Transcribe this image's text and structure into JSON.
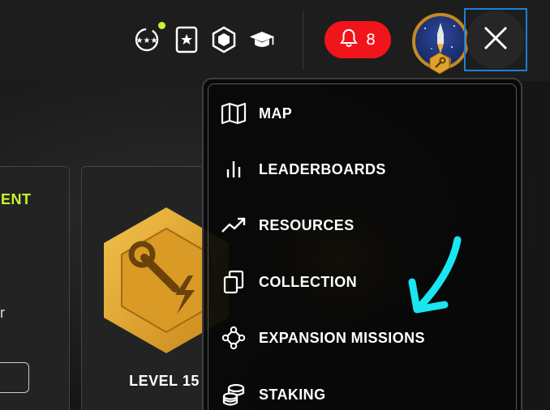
{
  "header": {
    "notifications": {
      "count": "8"
    }
  },
  "background": {
    "left_card": {
      "title_fragment": "ENT",
      "text_fragment": "r"
    },
    "mid_card": {
      "level_label": "LEVEL 15"
    }
  },
  "menu": {
    "items": [
      {
        "label": "MAP",
        "icon": "map-icon"
      },
      {
        "label": "LEADERBOARDS",
        "icon": "leaderboard-icon"
      },
      {
        "label": "RESOURCES",
        "icon": "trending-up-icon"
      },
      {
        "label": "COLLECTION",
        "icon": "collection-icon"
      },
      {
        "label": "EXPANSION MISSIONS",
        "icon": "expansion-icon"
      },
      {
        "label": "STAKING",
        "icon": "coins-icon"
      }
    ]
  },
  "colors": {
    "accent_green": "#c6f432",
    "notification_red": "#f0141b",
    "badge_gold": "#e0a32a",
    "annotation_cyan": "#19e6f0",
    "focus_blue": "#1f7fd6"
  }
}
